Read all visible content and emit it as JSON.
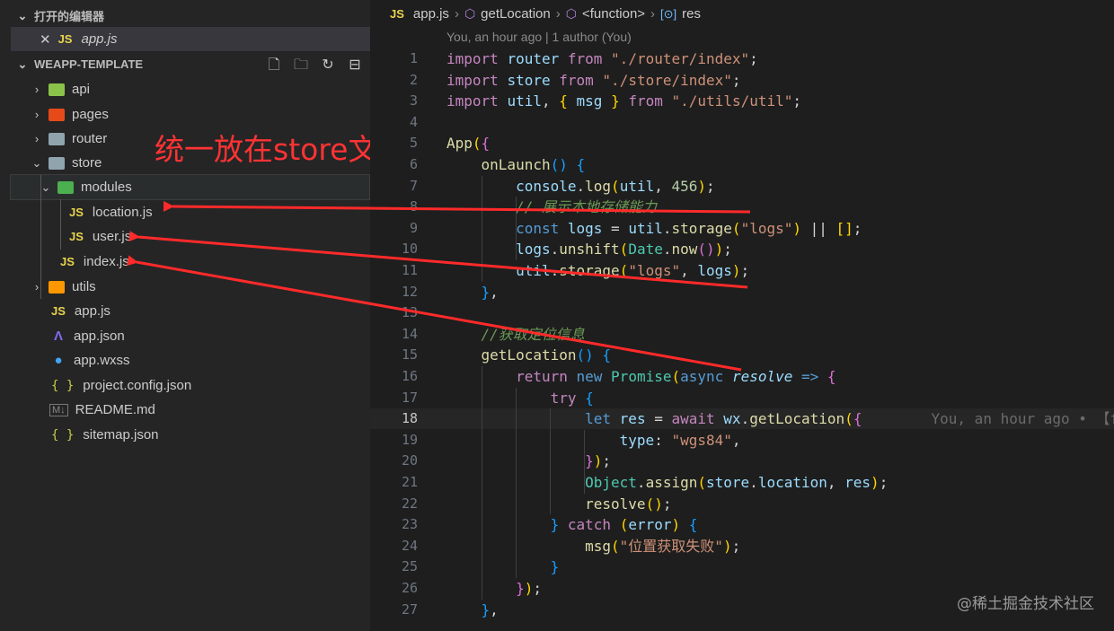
{
  "explorer": {
    "open_editors_title": "打开的编辑器",
    "open_file": {
      "close": "✕",
      "badge": "JS",
      "name": "app.js"
    },
    "project_title": "WEAPP-TEMPLATE",
    "toolbar_icons": [
      "new-file-icon",
      "new-folder-icon",
      "refresh-icon",
      "collapse-all-icon"
    ],
    "tree": [
      {
        "chevron": "›",
        "name": "api",
        "icon": "folder-api-icon",
        "color": "#8bc34a"
      },
      {
        "chevron": "›",
        "name": "pages",
        "icon": "folder-pages-icon",
        "color": "#e64a19"
      },
      {
        "chevron": "›",
        "name": "router",
        "icon": "folder-icon",
        "color": "#90a4ae"
      },
      {
        "chevron": "⌄",
        "name": "store",
        "icon": "folder-open-icon",
        "color": "#90a4ae"
      },
      {
        "chevron": "⌄",
        "name": "modules",
        "icon": "folder-modules-icon",
        "color": "#4caf50"
      },
      {
        "badge": "JS",
        "name": "location.js",
        "icon": "js-file-icon"
      },
      {
        "badge": "JS",
        "name": "user.js",
        "icon": "js-file-icon"
      },
      {
        "badge": "JS",
        "name": "index.js",
        "icon": "js-file-icon"
      },
      {
        "chevron": "›",
        "name": "utils",
        "icon": "folder-utils-icon",
        "color": "#ff9800"
      },
      {
        "badge": "JS",
        "name": "app.js",
        "icon": "js-file-icon"
      },
      {
        "name": "app.json",
        "icon": "app-json-icon",
        "glyph": "Λ",
        "color": "#7c6cf2"
      },
      {
        "name": "app.wxss",
        "icon": "wxss-icon",
        "glyph": "●",
        "color": "#42a5f5"
      },
      {
        "name": "project.config.json",
        "icon": "json-braces-icon",
        "glyph": "{ }",
        "color": "#cbcb41"
      },
      {
        "name": "README.md",
        "icon": "markdown-icon",
        "glyph": "M↓",
        "color": "#888888"
      },
      {
        "name": "sitemap.json",
        "icon": "json-braces-icon",
        "glyph": "{ }",
        "color": "#cbcb41"
      }
    ],
    "annotation": "统一放在store文件夹"
  },
  "editor": {
    "breadcrumb": {
      "badge": "JS",
      "file": "app.js",
      "sep": "›",
      "symbol1": "getLocation",
      "symbol2": "<function>",
      "symbol3": "res",
      "sym_glyph": "⬡",
      "var_glyph": "[⊙]"
    },
    "blame": "You, an hour ago | 1 author (You)",
    "current_line": 18,
    "lines": [
      {
        "n": "1",
        "tokens": [
          [
            "kw",
            "import"
          ],
          [
            "p",
            " "
          ],
          [
            "v",
            "router"
          ],
          [
            "p",
            " "
          ],
          [
            "kw",
            "from"
          ],
          [
            "p",
            " "
          ],
          [
            "s",
            "\"./router/index\""
          ],
          [
            "p",
            ";"
          ]
        ]
      },
      {
        "n": "2",
        "tokens": [
          [
            "kw",
            "import"
          ],
          [
            "p",
            " "
          ],
          [
            "v",
            "store"
          ],
          [
            "p",
            " "
          ],
          [
            "kw",
            "from"
          ],
          [
            "p",
            " "
          ],
          [
            "s",
            "\"./store/index\""
          ],
          [
            "p",
            ";"
          ]
        ]
      },
      {
        "n": "3",
        "tokens": [
          [
            "kw",
            "import"
          ],
          [
            "p",
            " "
          ],
          [
            "v",
            "util"
          ],
          [
            "p",
            ", "
          ],
          [
            "y",
            "{"
          ],
          [
            "p",
            " "
          ],
          [
            "v",
            "msg"
          ],
          [
            "p",
            " "
          ],
          [
            "y",
            "}"
          ],
          [
            "p",
            " "
          ],
          [
            "kw",
            "from"
          ],
          [
            "p",
            " "
          ],
          [
            "s",
            "\"./utils/util\""
          ],
          [
            "p",
            ";"
          ]
        ]
      },
      {
        "n": "4",
        "tokens": []
      },
      {
        "n": "5",
        "tokens": [
          [
            "fn",
            "App"
          ],
          [
            "y",
            "("
          ],
          [
            "pk",
            "{"
          ]
        ]
      },
      {
        "n": "6",
        "tokens": [
          [
            "p",
            "    "
          ],
          [
            "fn",
            "onLaunch"
          ],
          [
            "bl",
            "()"
          ],
          [
            "p",
            " "
          ],
          [
            "bl",
            "{"
          ]
        ]
      },
      {
        "n": "7",
        "tokens": [
          [
            "p",
            "        "
          ],
          [
            "v",
            "console"
          ],
          [
            "p",
            "."
          ],
          [
            "fn",
            "log"
          ],
          [
            "y",
            "("
          ],
          [
            "v",
            "util"
          ],
          [
            "p",
            ", "
          ],
          [
            "n",
            "456"
          ],
          [
            "y",
            ")"
          ],
          [
            "p",
            ";"
          ]
        ]
      },
      {
        "n": "8",
        "tokens": [
          [
            "p",
            "        "
          ],
          [
            "c",
            "// 展示本地存储能力"
          ]
        ]
      },
      {
        "n": "9",
        "tokens": [
          [
            "p",
            "        "
          ],
          [
            "kb",
            "const"
          ],
          [
            "p",
            " "
          ],
          [
            "v",
            "logs"
          ],
          [
            "p",
            " = "
          ],
          [
            "v",
            "util"
          ],
          [
            "p",
            "."
          ],
          [
            "fn",
            "storage"
          ],
          [
            "y",
            "("
          ],
          [
            "s",
            "\"logs\""
          ],
          [
            "y",
            ")"
          ],
          [
            "p",
            " || "
          ],
          [
            "y",
            "[]"
          ],
          [
            "p",
            ";"
          ]
        ]
      },
      {
        "n": "10",
        "tokens": [
          [
            "p",
            "        "
          ],
          [
            "v",
            "logs"
          ],
          [
            "p",
            "."
          ],
          [
            "fn",
            "unshift"
          ],
          [
            "y",
            "("
          ],
          [
            "ty",
            "Date"
          ],
          [
            "p",
            "."
          ],
          [
            "fn",
            "now"
          ],
          [
            "pk",
            "()"
          ],
          [
            "y",
            ")"
          ],
          [
            "p",
            ";"
          ]
        ]
      },
      {
        "n": "11",
        "tokens": [
          [
            "p",
            "        "
          ],
          [
            "v",
            "util"
          ],
          [
            "p",
            "."
          ],
          [
            "fn",
            "storage"
          ],
          [
            "y",
            "("
          ],
          [
            "s",
            "\"logs\""
          ],
          [
            "p",
            ", "
          ],
          [
            "v",
            "logs"
          ],
          [
            "y",
            ")"
          ],
          [
            "p",
            ";"
          ]
        ]
      },
      {
        "n": "12",
        "tokens": [
          [
            "p",
            "    "
          ],
          [
            "bl",
            "}"
          ],
          [
            "p",
            ","
          ]
        ]
      },
      {
        "n": "13",
        "tokens": []
      },
      {
        "n": "14",
        "tokens": [
          [
            "p",
            "    "
          ],
          [
            "c",
            "//获取定位信息"
          ]
        ]
      },
      {
        "n": "15",
        "tokens": [
          [
            "p",
            "    "
          ],
          [
            "fn",
            "getLocation"
          ],
          [
            "bl",
            "()"
          ],
          [
            "p",
            " "
          ],
          [
            "bl",
            "{"
          ]
        ]
      },
      {
        "n": "16",
        "tokens": [
          [
            "p",
            "        "
          ],
          [
            "kw",
            "return"
          ],
          [
            "p",
            " "
          ],
          [
            "kb",
            "new"
          ],
          [
            "p",
            " "
          ],
          [
            "ty",
            "Promise"
          ],
          [
            "y",
            "("
          ],
          [
            "kb",
            "async"
          ],
          [
            "p",
            " "
          ],
          [
            "pr",
            "resolve"
          ],
          [
            "p",
            " "
          ],
          [
            "kb",
            "=>"
          ],
          [
            "p",
            " "
          ],
          [
            "pk",
            "{"
          ]
        ]
      },
      {
        "n": "17",
        "tokens": [
          [
            "p",
            "            "
          ],
          [
            "kw",
            "try"
          ],
          [
            "p",
            " "
          ],
          [
            "bl",
            "{"
          ]
        ]
      },
      {
        "n": "18",
        "tokens": [
          [
            "p",
            "                "
          ],
          [
            "kb",
            "let"
          ],
          [
            "p",
            " "
          ],
          [
            "v",
            "res"
          ],
          [
            "p",
            " = "
          ],
          [
            "kw",
            "await"
          ],
          [
            "p",
            " "
          ],
          [
            "v",
            "wx"
          ],
          [
            "p",
            "."
          ],
          [
            "fn",
            "getLocation"
          ],
          [
            "y",
            "("
          ],
          [
            "pk",
            "{"
          ],
          [
            "ghost",
            "        You, an hour ago • 【fe"
          ]
        ]
      },
      {
        "n": "19",
        "tokens": [
          [
            "p",
            "                    "
          ],
          [
            "v",
            "type"
          ],
          [
            "p",
            ": "
          ],
          [
            "s",
            "\"wgs84\""
          ],
          [
            "p",
            ","
          ]
        ]
      },
      {
        "n": "20",
        "tokens": [
          [
            "p",
            "                "
          ],
          [
            "pk",
            "}"
          ],
          [
            "y",
            ")"
          ],
          [
            "p",
            ";"
          ]
        ]
      },
      {
        "n": "21",
        "tokens": [
          [
            "p",
            "                "
          ],
          [
            "ty",
            "Object"
          ],
          [
            "p",
            "."
          ],
          [
            "fn",
            "assign"
          ],
          [
            "y",
            "("
          ],
          [
            "v",
            "store"
          ],
          [
            "p",
            "."
          ],
          [
            "v",
            "location"
          ],
          [
            "p",
            ", "
          ],
          [
            "v",
            "res"
          ],
          [
            "y",
            ")"
          ],
          [
            "p",
            ";"
          ]
        ]
      },
      {
        "n": "22",
        "tokens": [
          [
            "p",
            "                "
          ],
          [
            "fn",
            "resolve"
          ],
          [
            "y",
            "()"
          ],
          [
            "p",
            ";"
          ]
        ]
      },
      {
        "n": "23",
        "tokens": [
          [
            "p",
            "            "
          ],
          [
            "bl",
            "}"
          ],
          [
            "p",
            " "
          ],
          [
            "kw",
            "catch"
          ],
          [
            "p",
            " "
          ],
          [
            "y",
            "("
          ],
          [
            "v",
            "error"
          ],
          [
            "y",
            ")"
          ],
          [
            "p",
            " "
          ],
          [
            "bl",
            "{"
          ]
        ]
      },
      {
        "n": "24",
        "tokens": [
          [
            "p",
            "                "
          ],
          [
            "fn",
            "msg"
          ],
          [
            "y",
            "("
          ],
          [
            "s",
            "\"位置获取失败\""
          ],
          [
            "y",
            ")"
          ],
          [
            "p",
            ";"
          ]
        ]
      },
      {
        "n": "25",
        "tokens": [
          [
            "p",
            "            "
          ],
          [
            "bl",
            "}"
          ]
        ]
      },
      {
        "n": "26",
        "tokens": [
          [
            "p",
            "        "
          ],
          [
            "pk",
            "}"
          ],
          [
            "y",
            ")"
          ],
          [
            "p",
            ";"
          ]
        ]
      },
      {
        "n": "27",
        "tokens": [
          [
            "p",
            "    "
          ],
          [
            "bl",
            "}"
          ],
          [
            "p",
            ","
          ]
        ]
      }
    ]
  },
  "watermark": "@稀土掘金技术社区"
}
